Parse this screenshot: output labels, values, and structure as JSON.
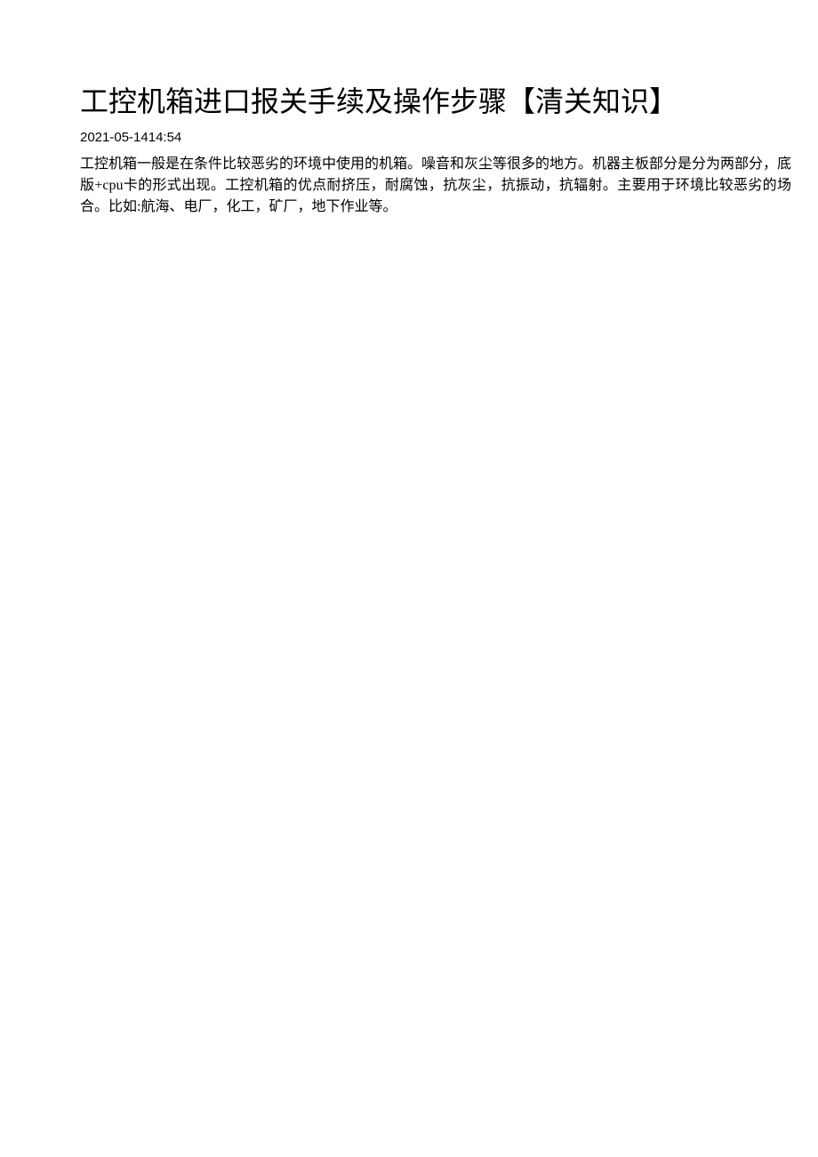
{
  "document": {
    "title": "工控机箱进口报关手续及操作步骤【清关知识】",
    "timestamp": "2021-05-1414:54",
    "body": "工控机箱一般是在条件比较恶劣的环境中使用的机箱。噪音和灰尘等很多的地方。机器主板部分是分为两部分，底版+cpu卡的形式出现。工控机箱的优点耐挤压，耐腐蚀，抗灰尘，抗振动，抗辐射。主要用于环境比较恶劣的场合。比如:航海、电厂，化工，矿厂，地下作业等。"
  }
}
